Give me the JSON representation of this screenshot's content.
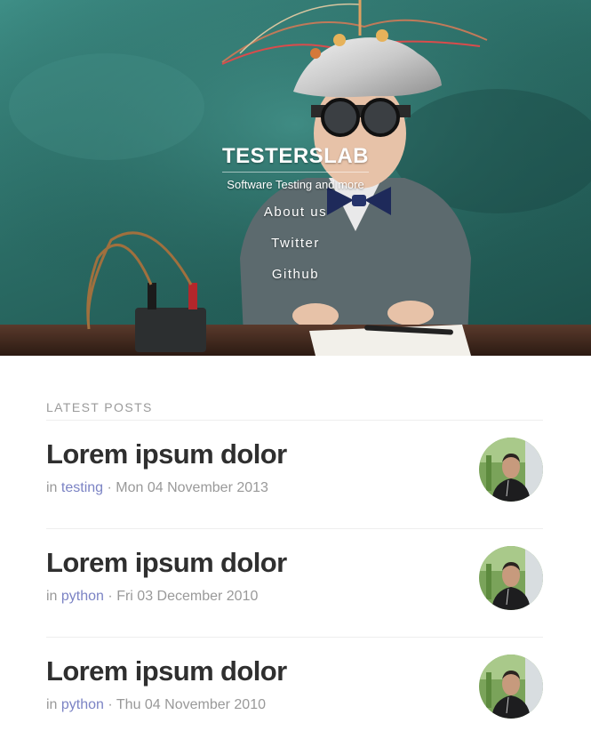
{
  "site": {
    "title": "TESTERSLAB",
    "subtitle": "Software Testing and more"
  },
  "nav": [
    {
      "label": "About us"
    },
    {
      "label": "Twitter"
    },
    {
      "label": "Github"
    }
  ],
  "latest": {
    "heading": "LATEST POSTS"
  },
  "posts": [
    {
      "title": "Lorem ipsum dolor",
      "prefix": "in",
      "category": "testing",
      "separator": "·",
      "date": "Mon 04 November 2013"
    },
    {
      "title": "Lorem ipsum dolor",
      "prefix": "in",
      "category": "python",
      "separator": "·",
      "date": "Fri 03 December 2010"
    },
    {
      "title": "Lorem ipsum dolor",
      "prefix": "in",
      "category": "python",
      "separator": "·",
      "date": "Thu 04 November 2010"
    }
  ],
  "colors": {
    "hero_teal": "#2a6b64",
    "link": "#7b83c4",
    "title_text": "#2f2f2f",
    "meta_text": "#999999"
  }
}
